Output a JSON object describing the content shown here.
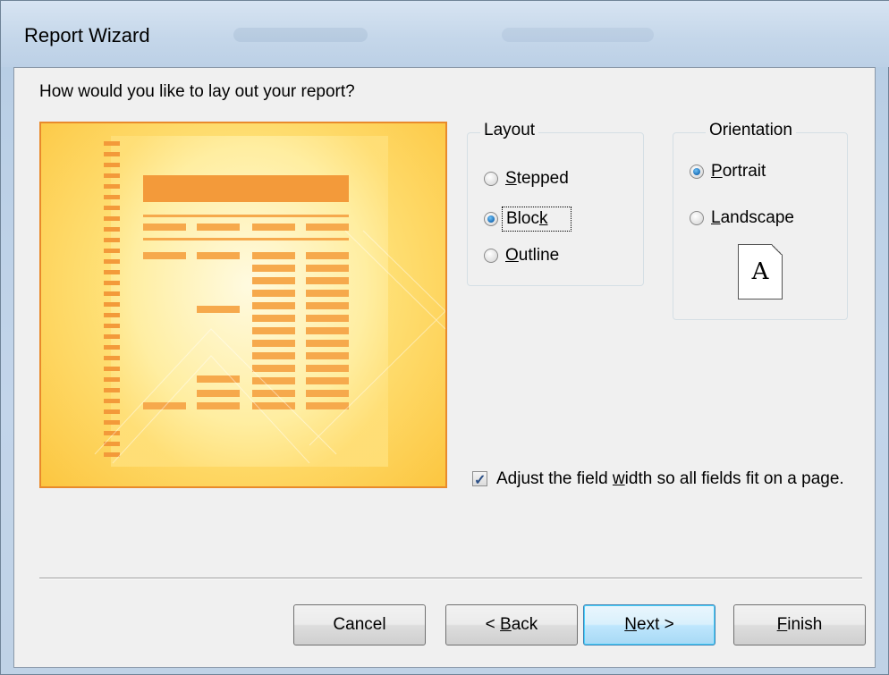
{
  "window": {
    "title": "Report Wizard"
  },
  "question": "How would you like to lay out your report?",
  "layout": {
    "label": "Layout",
    "options": [
      {
        "pre": "",
        "key": "S",
        "post": "tepped",
        "checked": false
      },
      {
        "pre": "Bloc",
        "key": "k",
        "post": "",
        "checked": true
      },
      {
        "pre": "",
        "key": "O",
        "post": "utline",
        "checked": false
      }
    ]
  },
  "orientation": {
    "label": "Orientation",
    "options": [
      {
        "pre": "",
        "key": "P",
        "post": "ortrait",
        "checked": true
      },
      {
        "pre": "",
        "key": "L",
        "post": "andscape",
        "checked": false
      }
    ],
    "page_icon_letter": "A"
  },
  "adjust": {
    "checked": true,
    "pre": "Adjust the field ",
    "key": "w",
    "post": "idth so all fields fit on a page."
  },
  "buttons": {
    "cancel": "Cancel",
    "back": {
      "pre": "< ",
      "key": "B",
      "post": "ack"
    },
    "next": {
      "pre": "",
      "key": "N",
      "post": "ext >"
    },
    "finish": {
      "pre": "",
      "key": "F",
      "post": "inish"
    }
  },
  "colors": {
    "preview_border": "#e98a2b",
    "preview_bar": "#f39a3a",
    "accent_blue": "#3c7fb1"
  }
}
